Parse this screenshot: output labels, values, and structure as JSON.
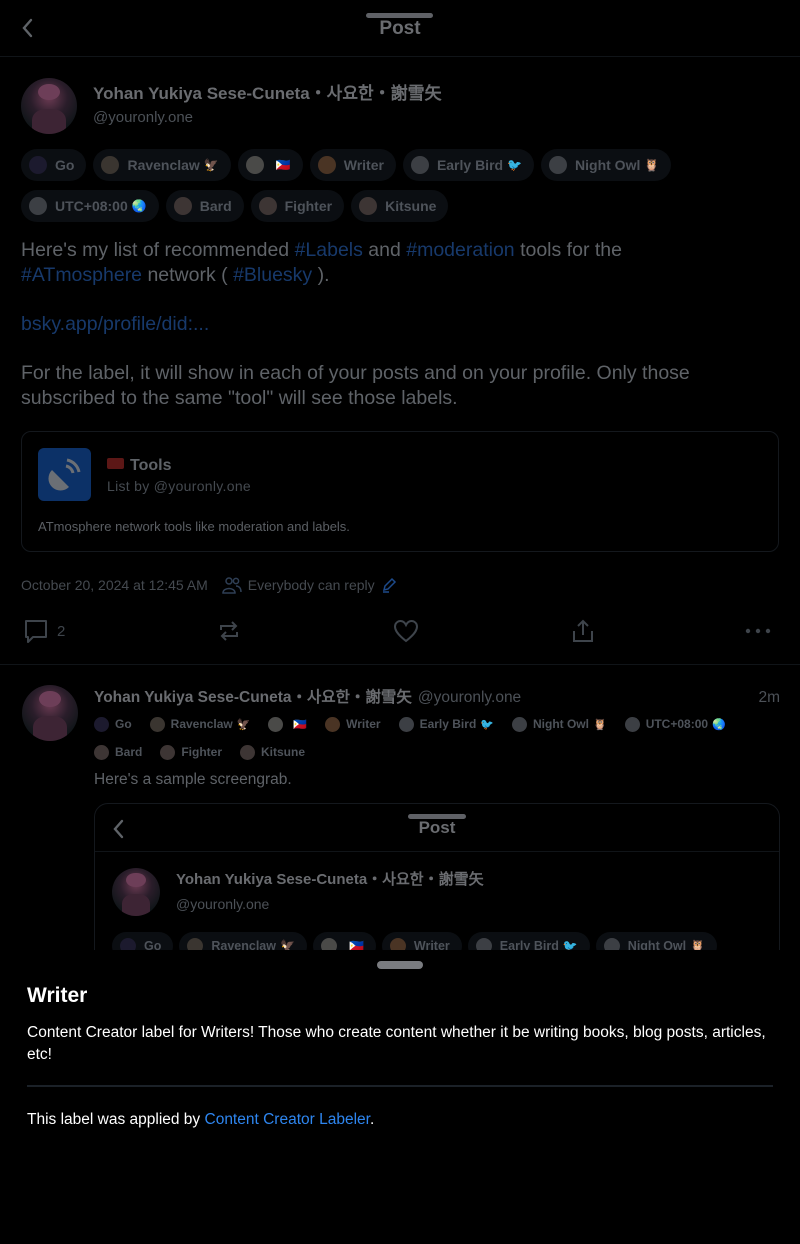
{
  "header": {
    "title": "Post",
    "back_icon": "chevron-left-icon"
  },
  "post": {
    "author": {
      "display_name": "Yohan Yukiya Sese-Cuneta・사요한・謝雪矢",
      "handle": "@youronly.one"
    },
    "labels": [
      {
        "text": "Go",
        "emoji": ""
      },
      {
        "text": "Ravenclaw",
        "emoji": "🦅"
      },
      {
        "text": "",
        "emoji": "🇵🇭"
      },
      {
        "text": "Writer",
        "emoji": ""
      },
      {
        "text": "Early Bird",
        "emoji": "🐦"
      },
      {
        "text": "Night Owl",
        "emoji": "🦉"
      },
      {
        "text": "UTC+08:00",
        "emoji": "🌏"
      },
      {
        "text": "Bard",
        "emoji": ""
      },
      {
        "text": "Fighter",
        "emoji": ""
      },
      {
        "text": "Kitsune",
        "emoji": ""
      }
    ],
    "body": {
      "line1_a": "Here's my list of recommended ",
      "tag_labels": "#Labels",
      "line1_b": " and ",
      "tag_moderation": "#moderation",
      "line1_c": " tools for the ",
      "tag_atmosphere": "#ATmosphere",
      "line1_d": " network ( ",
      "tag_bluesky": "#Bluesky",
      "line1_e": " ).",
      "link": "bsky.app/profile/did:...",
      "para2": "For the label, it will show in each of your posts and on your profile. Only those subscribed to the same \"tool\" will see those labels."
    },
    "list_card": {
      "emoji_icon": "toolbox-icon",
      "title": "Tools",
      "byline": "List by @youronly.one",
      "description": "ATmosphere network tools like moderation and labels."
    },
    "timestamp": "October 20, 2024 at 12:45 AM",
    "reply_setting": "Everybody can reply",
    "actions": {
      "reply_count": "2",
      "repost_count": "",
      "like_count": ""
    }
  },
  "reply": {
    "author": {
      "display_name": "Yohan Yukiya Sese-Cuneta・사요한・謝雪矢",
      "handle": "@youronly.one"
    },
    "time": "2m",
    "labels": [
      {
        "text": "Go",
        "emoji": ""
      },
      {
        "text": "Ravenclaw",
        "emoji": "🦅"
      },
      {
        "text": "",
        "emoji": "🇵🇭"
      },
      {
        "text": "Writer",
        "emoji": ""
      },
      {
        "text": "Early Bird",
        "emoji": "🐦"
      },
      {
        "text": "Night Owl",
        "emoji": "🦉"
      },
      {
        "text": "UTC+08:00",
        "emoji": "🌏"
      },
      {
        "text": "Bard",
        "emoji": ""
      },
      {
        "text": "Fighter",
        "emoji": ""
      },
      {
        "text": "Kitsune",
        "emoji": ""
      }
    ],
    "text": "Here's a sample screengrab.",
    "embed": {
      "title": "Post",
      "display_name": "Yohan Yukiya Sese-Cuneta・사요한・謝雪矢",
      "handle": "@youronly.one",
      "labels": [
        {
          "text": "Go",
          "emoji": ""
        },
        {
          "text": "Ravenclaw",
          "emoji": "🦅"
        },
        {
          "text": "",
          "emoji": "🇵🇭"
        },
        {
          "text": "Writer",
          "emoji": ""
        },
        {
          "text": "Early Bird",
          "emoji": "🐦"
        },
        {
          "text": "Night Owl",
          "emoji": "🦉"
        }
      ]
    }
  },
  "sheet": {
    "title": "Writer",
    "description": "Content Creator label for Writers! Those who create content whether it be writing books, blog posts, articles, etc!",
    "applied_prefix": "This label was applied by ",
    "applied_link": "Content Creator Labeler",
    "applied_suffix": ".",
    "link_color": "#2e86f0"
  }
}
